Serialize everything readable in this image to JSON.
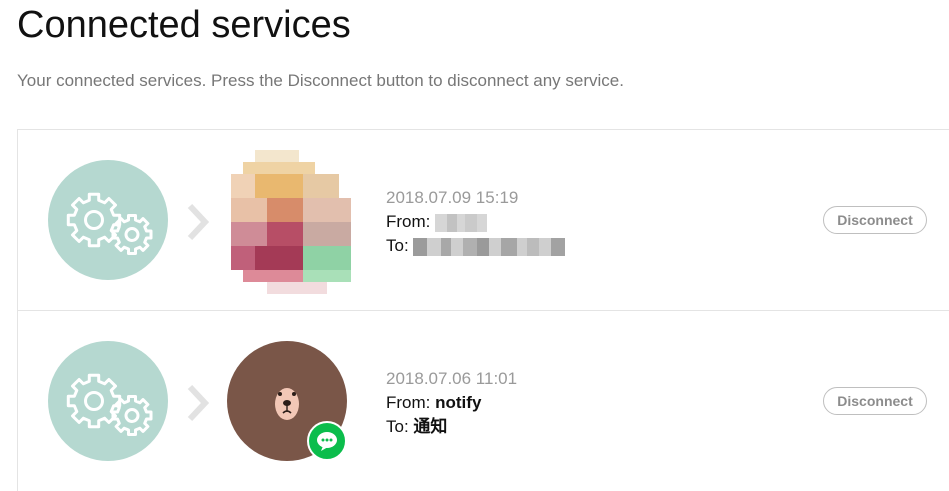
{
  "page": {
    "title": "Connected services",
    "description": "Your connected services. Press the Disconnect button to disconnect any service."
  },
  "services": [
    {
      "date": "2018.07.09 15:19",
      "from_label": "From:",
      "from_value": "",
      "to_label": "To:",
      "to_value": "",
      "thumbnail": "pixelated-image",
      "disconnect_label": "Disconnect"
    },
    {
      "date": "2018.07.06 11:01",
      "from_label": "From:",
      "from_value": "notify",
      "to_label": "To:",
      "to_value": "通知",
      "thumbnail": "brown-bear-avatar",
      "badge_icon": "line-chat-icon",
      "disconnect_label": "Disconnect"
    }
  ],
  "icons": {
    "gear": "gears-icon",
    "arrow": "chevron-right-icon"
  },
  "colors": {
    "gear_circle": "#b5d8d0",
    "bear": "#7a5648",
    "line_green": "#0bbd4c",
    "button_border": "#bfbfbf",
    "muted_text": "#9a9a9a"
  }
}
